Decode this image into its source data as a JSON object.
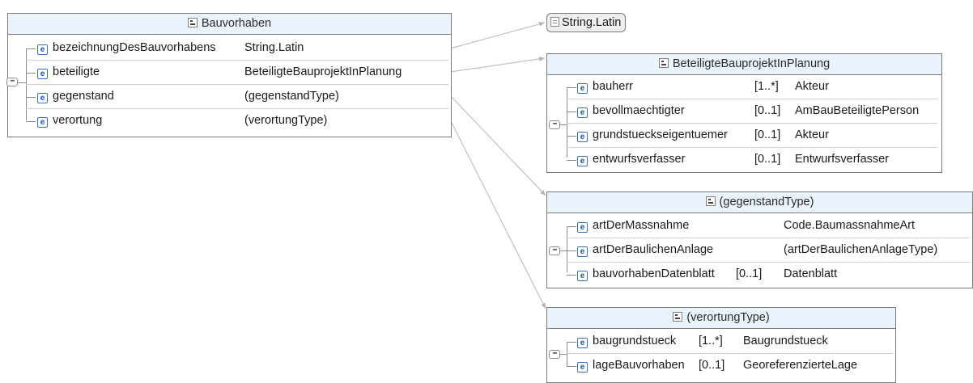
{
  "colors": {
    "header_bg": "#eaf2fb",
    "border": "#7a7a7a",
    "element_icon": "#1d4f99",
    "connector": "#b5b5b5"
  },
  "icons": {
    "complex_type": "complex-type-icon",
    "element": "element-icon",
    "sequence": "sequence-icon",
    "simple_type": "simple-type-icon"
  },
  "bauvorhaben": {
    "title": "Bauvorhaben",
    "elements": [
      {
        "icon": "e",
        "name": "bezeichnungDesBauvorhabens",
        "type": "String.Latin"
      },
      {
        "icon": "e",
        "name": "beteiligte",
        "type": "BeteiligteBauprojektInPlanung"
      },
      {
        "icon": "e",
        "name": "gegenstand",
        "type": "(gegenstandType)"
      },
      {
        "icon": "e",
        "name": "verortung",
        "type": "(verortungType)"
      }
    ]
  },
  "string_latin": {
    "title": "String.Latin"
  },
  "beteiligte_box": {
    "title": "BeteiligteBauprojektInPlanung",
    "elements": [
      {
        "icon": "e",
        "name": "bauherr",
        "card": "[1..*]",
        "type": "Akteur"
      },
      {
        "icon": "e",
        "name": "bevollmaechtigter",
        "card": "[0..1]",
        "type": "AmBauBeteiligtePerson"
      },
      {
        "icon": "e",
        "name": "grundstueckseigentuemer",
        "card": "[0..1]",
        "type": "Akteur"
      },
      {
        "icon": "e",
        "name": "entwurfsverfasser",
        "card": "[0..1]",
        "type": "Entwurfsverfasser"
      }
    ]
  },
  "gegenstand_box": {
    "title": "(gegenstandType)",
    "elements": [
      {
        "icon": "e",
        "name": "artDerMassnahme",
        "card": "",
        "type": "Code.BaumassnahmeArt"
      },
      {
        "icon": "e",
        "name": "artDerBaulichenAnlage",
        "card": "",
        "type": "(artDerBaulichenAnlageType)"
      },
      {
        "icon": "e",
        "name": "bauvorhabenDatenblatt",
        "card": "[0..1]",
        "type": "Datenblatt"
      }
    ]
  },
  "verortung_box": {
    "title": "(verortungType)",
    "elements": [
      {
        "icon": "e",
        "name": "baugrundstueck",
        "card": "[1..*]",
        "type": "Baugrundstueck"
      },
      {
        "icon": "e",
        "name": "lageBauvorhaben",
        "card": "[0..1]",
        "type": "GeoreferenzierteLage"
      }
    ]
  }
}
